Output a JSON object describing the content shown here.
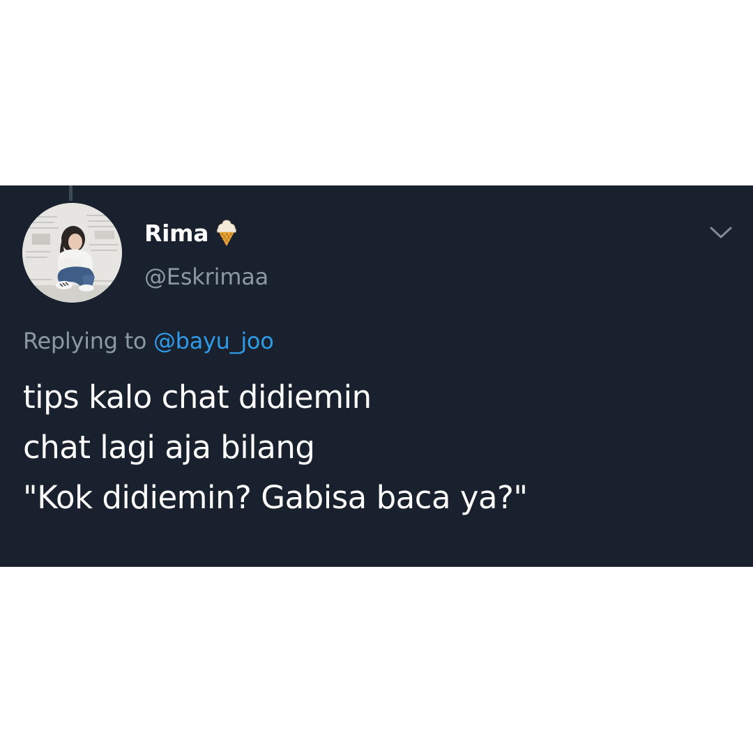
{
  "tweet": {
    "display_name": "Rima",
    "handle": "@Eskrimaa",
    "name_emoji_icon": "ice-cream-icon",
    "menu_icon": "chevron-down-icon",
    "avatar_icon": "avatar-photo",
    "reply": {
      "prefix": "Replying to",
      "mention": "@bayu_joo"
    },
    "text_lines": [
      "tips kalo chat didiemin",
      "chat lagi aja bilang",
      "\"Kok didiemin? Gabisa baca ya?\""
    ]
  },
  "colors": {
    "card_background": "#18212d",
    "page_background": "#ffffff",
    "name_text": "#ffffff",
    "secondary_text": "#8b98a6",
    "mention_link": "#2f9be6",
    "thread_line": "#3d4a58"
  }
}
